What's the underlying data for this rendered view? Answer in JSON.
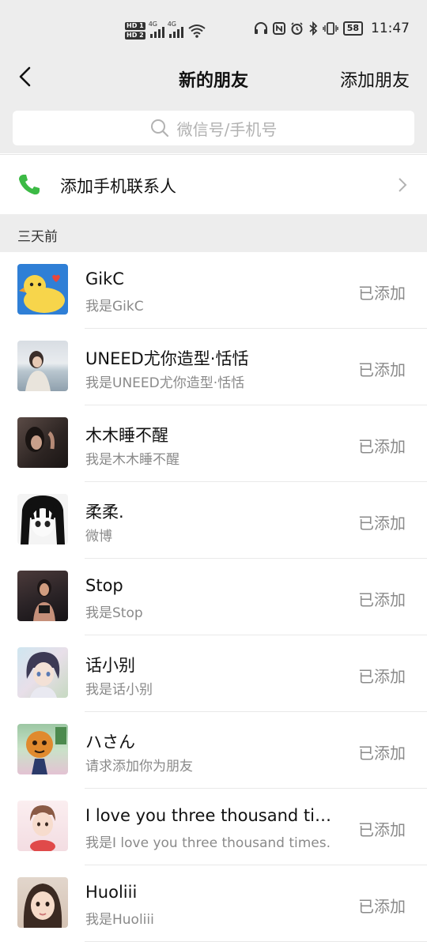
{
  "status_bar": {
    "time": "11:47",
    "battery": "58",
    "hd1": "HD 1",
    "hd2": "HD 2",
    "net1": "4G",
    "net2": "4G"
  },
  "nav": {
    "back_icon": "back-chevron-icon",
    "title": "新的朋友",
    "action": "添加朋友"
  },
  "search": {
    "placeholder": "微信号/手机号",
    "icon": "search-icon"
  },
  "phone_contacts": {
    "label": "添加手机联系人",
    "icon": "phone-icon",
    "icon_color": "#3cba45"
  },
  "section": {
    "label": "三天前"
  },
  "friends": [
    {
      "name": "GikC",
      "message": "我是GikC",
      "status": "已添加",
      "avatar": "duck-avatar"
    },
    {
      "name": "UNEED尤你造型·恬恬",
      "message": "我是UNEED尤你造型·恬恬",
      "status": "已添加",
      "avatar": "photo-avatar"
    },
    {
      "name": "木木睡不醒",
      "message": "我是木木睡不醒",
      "status": "已添加",
      "avatar": "photo-avatar"
    },
    {
      "name": "柔柔.",
      "message": "微博",
      "status": "已添加",
      "avatar": "manga-avatar"
    },
    {
      "name": "Stop",
      "message": "我是Stop",
      "status": "已添加",
      "avatar": "photo-avatar"
    },
    {
      "name": "话小别",
      "message": "我是话小别",
      "status": "已添加",
      "avatar": "anime-avatar"
    },
    {
      "name": "ハさん",
      "message": "请求添加你为朋友",
      "status": "已添加",
      "avatar": "cartoon-avatar"
    },
    {
      "name": "I love you three thousand ti…",
      "message": "我是I love you three thousand times.",
      "status": "已添加",
      "avatar": "illustration-avatar"
    },
    {
      "name": "Huoliii",
      "message": "我是Huoliii",
      "status": "已添加",
      "avatar": "photo-avatar"
    }
  ]
}
